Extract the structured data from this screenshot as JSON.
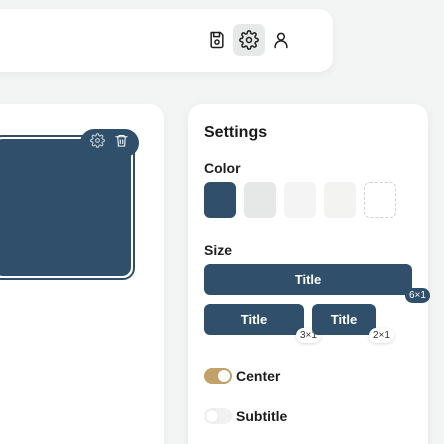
{
  "settings": {
    "title": "Settings",
    "color_label": "Color",
    "size_label": "Size",
    "swatches": [
      {
        "color": "#2f4f6b",
        "selected": true
      },
      {
        "color": "#e6e7e7",
        "selected": false
      },
      {
        "color": "#f4f4f4",
        "selected": false
      },
      {
        "color": "#f3f3f2",
        "selected": false
      },
      {
        "color": "transparent",
        "selected": false
      }
    ],
    "sizes": [
      {
        "label": "Title",
        "badge": "6×1"
      },
      {
        "label": "Title",
        "badge": "3×1"
      },
      {
        "label": "Title",
        "badge": "2×1"
      }
    ],
    "toggles": [
      {
        "label": "Center",
        "on": true
      },
      {
        "label": "Subtitle",
        "on": false
      }
    ]
  },
  "colors": {
    "accent": "#2f4f6b",
    "toggle_on": "#c2a06a"
  },
  "toolbar": {
    "icons": [
      "save-icon",
      "gear-icon",
      "user-icon"
    ],
    "active": "gear-icon"
  },
  "widget": {
    "toolbar_icons": [
      "gear-icon",
      "trash-icon"
    ]
  }
}
